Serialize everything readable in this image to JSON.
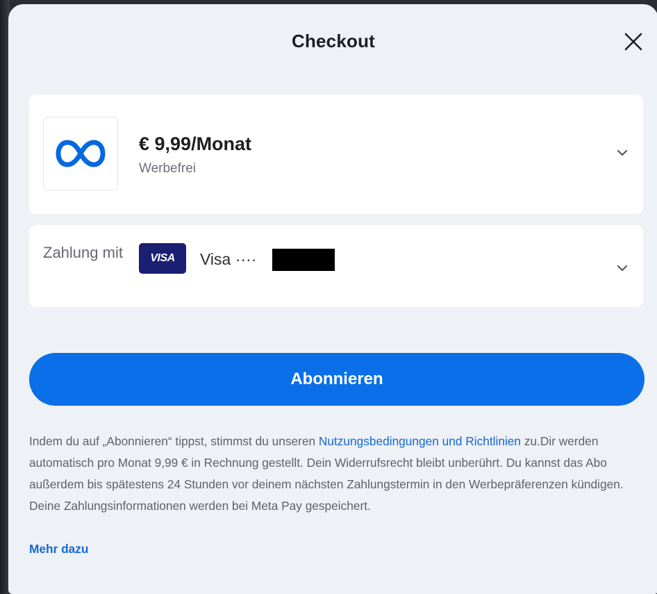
{
  "dialog": {
    "title": "Checkout"
  },
  "plan": {
    "price": "€ 9,99/Monat",
    "subtitle": "Werbefrei",
    "logo_icon": "meta-infinity-logo",
    "brand_color": "#0668e1"
  },
  "payment": {
    "label": "Zahlung mit",
    "card_brand_badge": "VISA",
    "card_name": "Visa ····",
    "card_number_redacted": true
  },
  "actions": {
    "subscribe_label": "Abonnieren",
    "subscribe_color": "#0a6fe8"
  },
  "legal": {
    "text_1": "Indem du auf „Abonnieren“ tippst, stimmst du unseren ",
    "terms_link": "Nutzungsbedingungen und Richtlinien",
    "text_2": " zu.Dir werden automatisch pro Monat 9,99 € in Rechnung gestellt. Dein Widerrufsrecht bleibt unberührt. Du kannst das Abo außerdem bis spätestens 24 Stunden vor deinem nächsten Zahlungstermin in den Werbepräferenzen kündigen. Deine Zahlungsinformationen werden bei Meta Pay gespeichert.",
    "more_link": "Mehr dazu",
    "link_color": "#1668d6"
  }
}
